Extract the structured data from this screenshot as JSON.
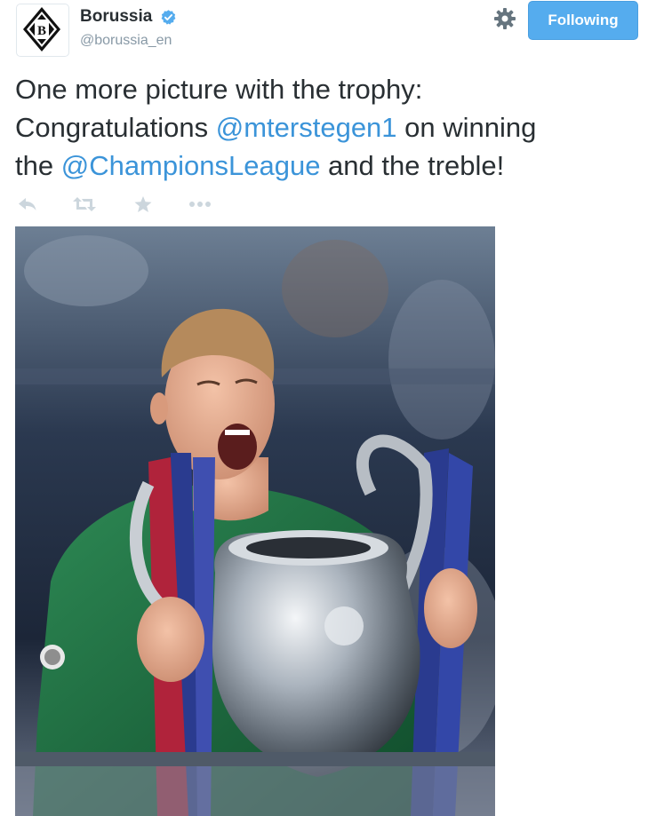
{
  "account": {
    "display_name": "Borussia",
    "handle": "@borussia_en",
    "verified": true,
    "avatar_icon": "borussia-crest-icon"
  },
  "header": {
    "settings_icon": "gear-icon",
    "follow_button_label": "Following"
  },
  "tweet": {
    "line1": "One more picture with the trophy:",
    "line2_prefix": "Congratulations ",
    "mention1": "@mterstegen1",
    "line2_suffix": " on winning",
    "line3_prefix": "the ",
    "mention2": "@ChampionsLeague",
    "line3_suffix": " and the treble!"
  },
  "actions": [
    {
      "name": "reply",
      "icon": "reply-icon"
    },
    {
      "name": "retweet",
      "icon": "retweet-icon"
    },
    {
      "name": "favorite",
      "icon": "star-icon"
    },
    {
      "name": "more",
      "icon": "more-dots-icon"
    }
  ],
  "colors": {
    "accent": "#55acee",
    "mention": "#3b94d9",
    "text": "#292f33",
    "muted": "#8899a6",
    "action_icon": "#ccd6dd"
  }
}
